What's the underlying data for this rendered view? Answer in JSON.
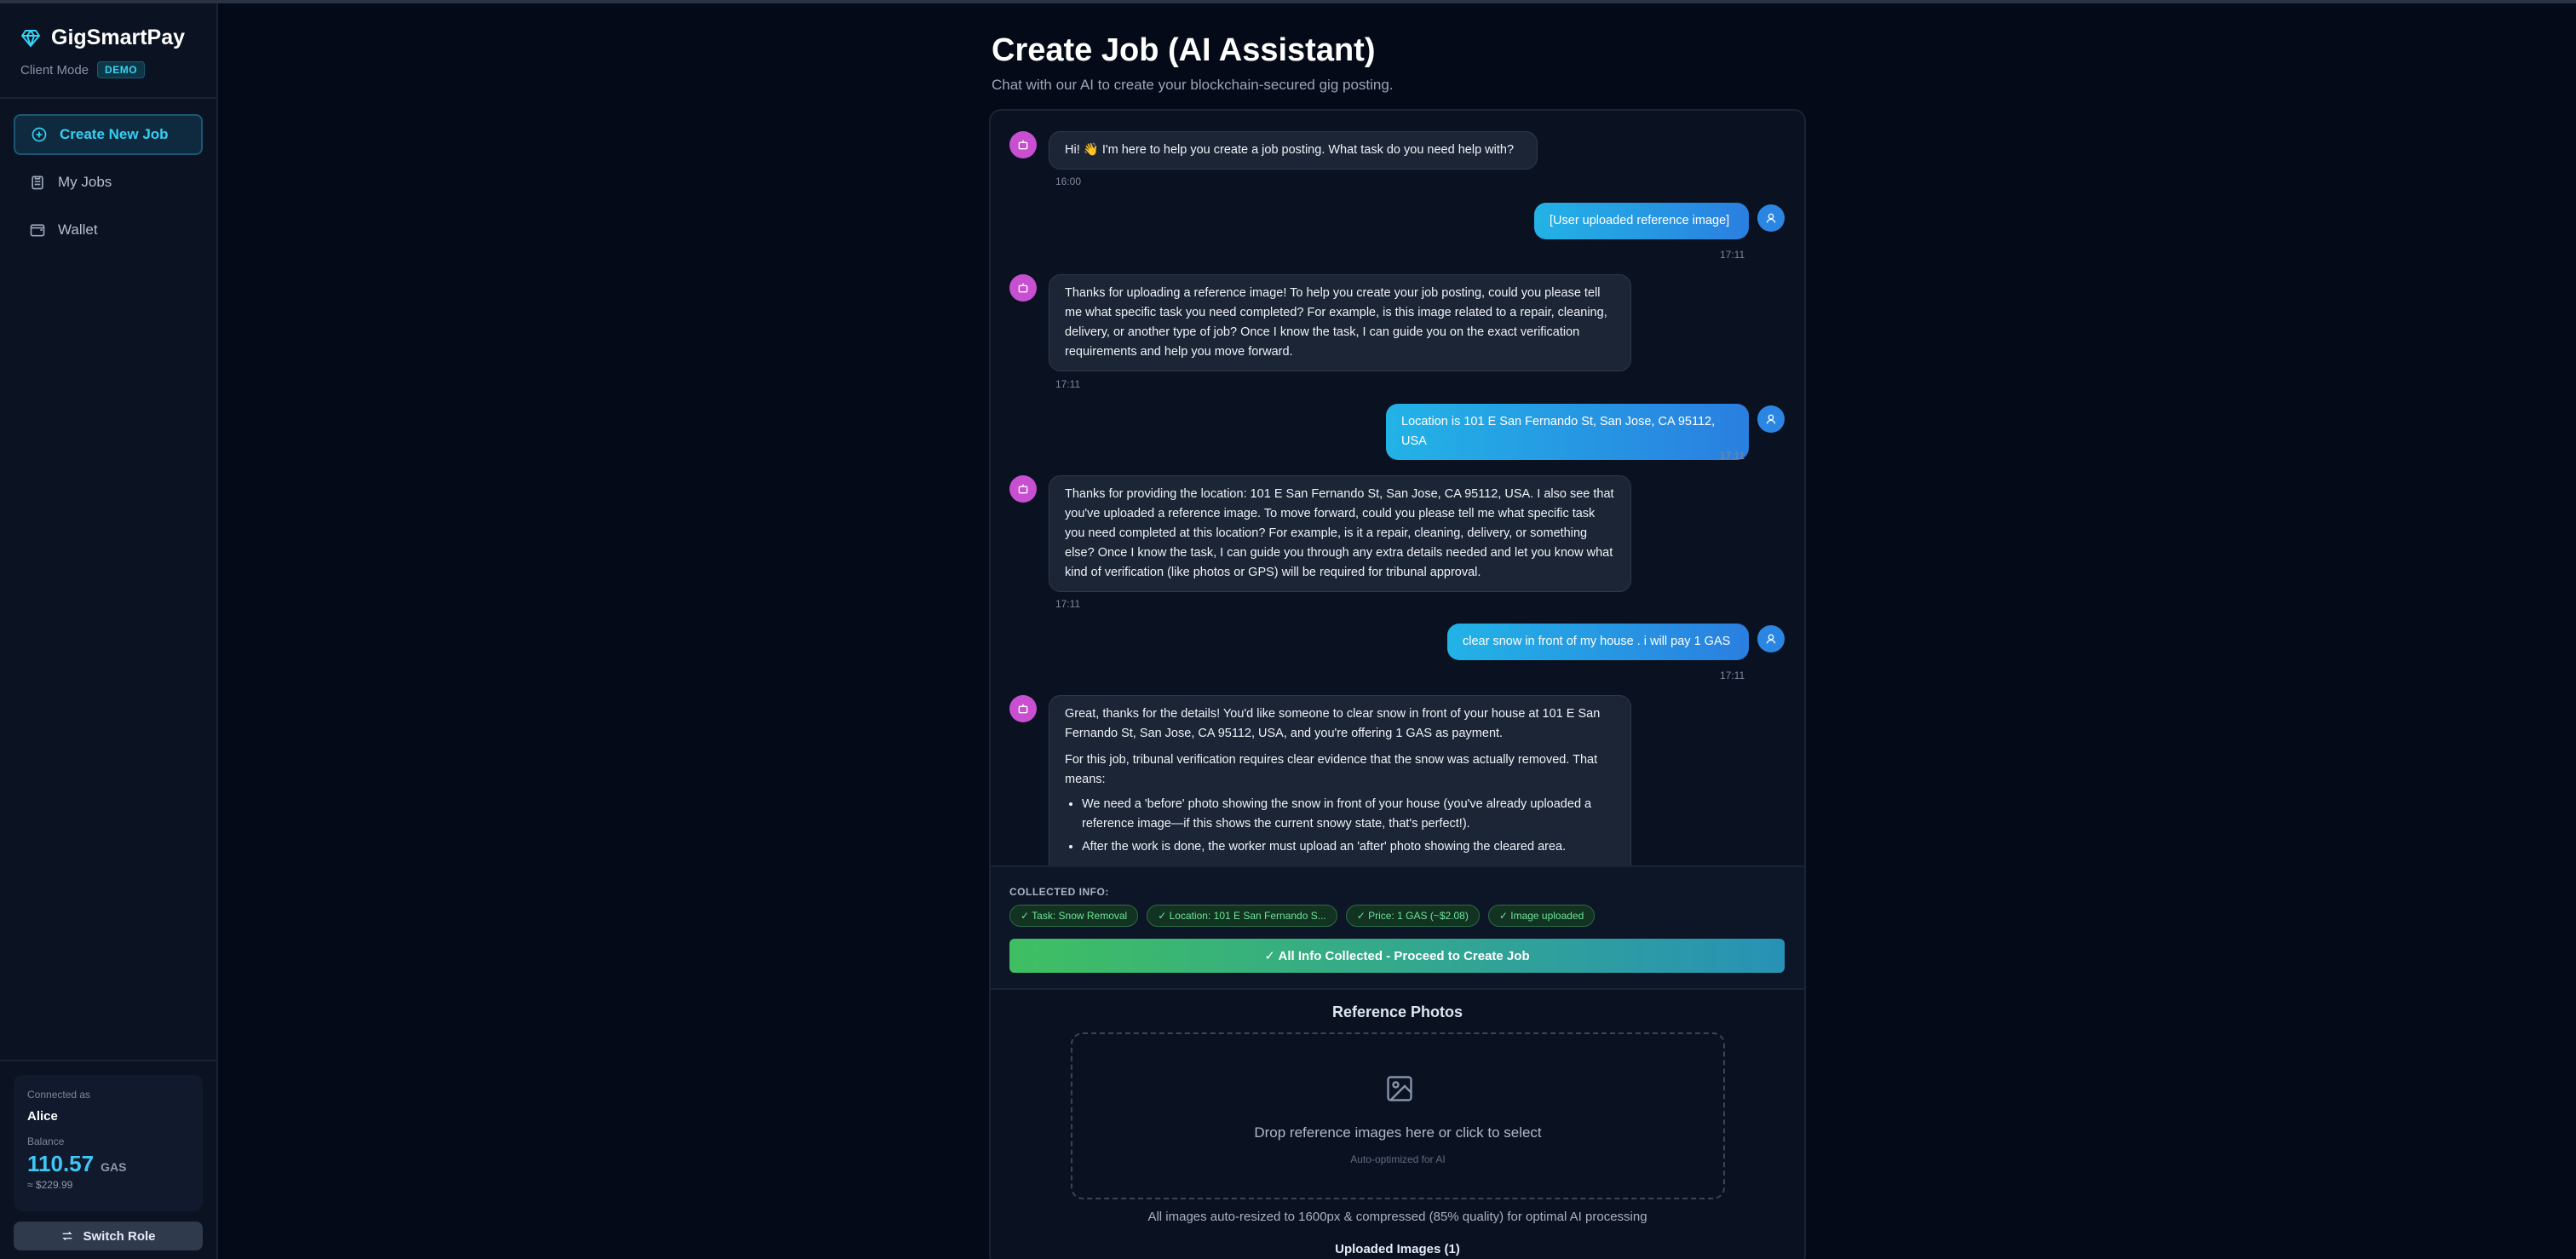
{
  "sidebar": {
    "brand": "GigSmartPay",
    "mode_label": "Client Mode",
    "mode_badge": "DEMO",
    "nav": [
      {
        "label": "Create New Job",
        "icon": "plus-circle-icon",
        "active": true
      },
      {
        "label": "My Jobs",
        "icon": "clipboard-icon",
        "active": false
      },
      {
        "label": "Wallet",
        "icon": "wallet-icon",
        "active": false
      }
    ],
    "account": {
      "connected_label": "Connected as",
      "name": "Alice",
      "balance_label": "Balance",
      "balance": "110.57",
      "unit": "GAS",
      "usd": "≈ $229.99"
    },
    "switch_role": "Switch Role"
  },
  "page": {
    "title": "Create Job (AI Assistant)",
    "subtitle": "Chat with our AI to create your blockchain-secured gig posting."
  },
  "chat": {
    "messages": [
      {
        "role": "ai",
        "text": "Hi! 👋 I'm here to help you create a job posting. What task do you need help with?",
        "time": "16:00"
      },
      {
        "role": "user",
        "text": "[User uploaded reference image]",
        "time": "17:11"
      },
      {
        "role": "ai",
        "text": "Thanks for uploading a reference image! To help you create your job posting, could you please tell me what specific task you need completed? For example, is this image related to a repair, cleaning, delivery, or another type of job? Once I know the task, I can guide you on the exact verification requirements and help you move forward.",
        "time": "17:11"
      },
      {
        "role": "user",
        "text": "Location is 101 E San Fernando St, San Jose, CA 95112, USA",
        "time": "17:11"
      },
      {
        "role": "ai",
        "text": "Thanks for providing the location: 101 E San Fernando St, San Jose, CA 95112, USA. I also see that you've uploaded a reference image. To move forward, could you please tell me what specific task you need completed at this location? For example, is it a repair, cleaning, delivery, or something else? Once I know the task, I can guide you through any extra details needed and let you know what kind of verification (like photos or GPS) will be required for tribunal approval.",
        "time": "17:11"
      },
      {
        "role": "user",
        "text": "clear snow in front of my house . i will pay 1 GAS",
        "time": "17:11"
      },
      {
        "role": "ai",
        "p1": "Great, thanks for the details! You'd like someone to clear snow in front of your house at 101 E San Fernando St, San Jose, CA 95112, USA, and you're offering 1 GAS as payment.",
        "p2": "For this job, tribunal verification requires clear evidence that the snow was actually removed. That means:",
        "bullets": [
          "We need a 'before' photo showing the snow in front of your house (you've already uploaded a reference image—if this shows the current snowy state, that's perfect!).",
          "After the work is done, the worker must upload an 'after' photo showing the cleared area."
        ]
      }
    ]
  },
  "collected": {
    "label": "COLLECTED INFO:",
    "chips": [
      "✓ Task: Snow Removal",
      "✓ Location: 101 E San Fernando S...",
      "✓ Price: 1 GAS (~$2.08)",
      "✓ Image uploaded"
    ],
    "proceed": "✓ All Info Collected - Proceed to Create Job"
  },
  "reference": {
    "title": "Reference Photos",
    "drop_text": "Drop reference images here or click to select",
    "drop_sub": "Auto-optimized for AI",
    "note": "All images auto-resized to 1600px & compressed (85% quality) for optimal AI processing",
    "uploaded_title": "Uploaded Images (1)"
  },
  "colors": {
    "accent": "#34d0f3",
    "ai_avatar": "#c94fd1",
    "user_bubble": "#2a7fe0",
    "chip_green": "#6de39a"
  }
}
